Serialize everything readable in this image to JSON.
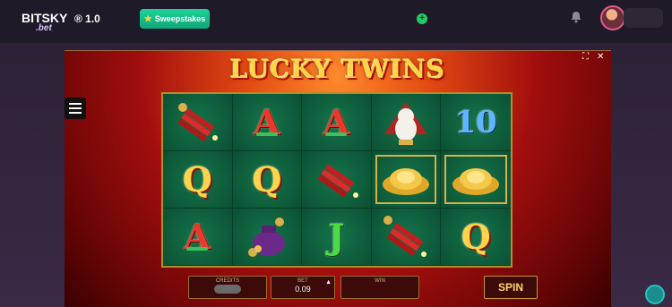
{
  "header": {
    "logo_text": "BITSKY",
    "logo_sub": ".bet",
    "logo_version": "® 1.0",
    "sweepstakes_label": "Sweepstakes"
  },
  "game": {
    "title": "LUCKY TWINS",
    "reels": [
      [
        "firecrackers",
        "A",
        "A",
        "cat",
        "10"
      ],
      [
        "Q",
        "Q",
        "firecrackers",
        "ingot",
        "ingot"
      ],
      [
        "A",
        "coinbag",
        "J",
        "firecrackers",
        "Q"
      ]
    ],
    "controls": {
      "credits_label": "CREDITS",
      "bet_label": "BET",
      "bet_value": "0.09",
      "win_label": "WIN",
      "spin_label": "SPIN"
    }
  },
  "colors": {
    "reel_bg": "#0f5c35",
    "gold": "#ffd545",
    "accent": "#1dd29a"
  },
  "icons": [
    "hamburger-menu-icon",
    "star-icon",
    "plus-icon",
    "bell-icon",
    "expand-icon",
    "close-icon",
    "chat-icon"
  ]
}
